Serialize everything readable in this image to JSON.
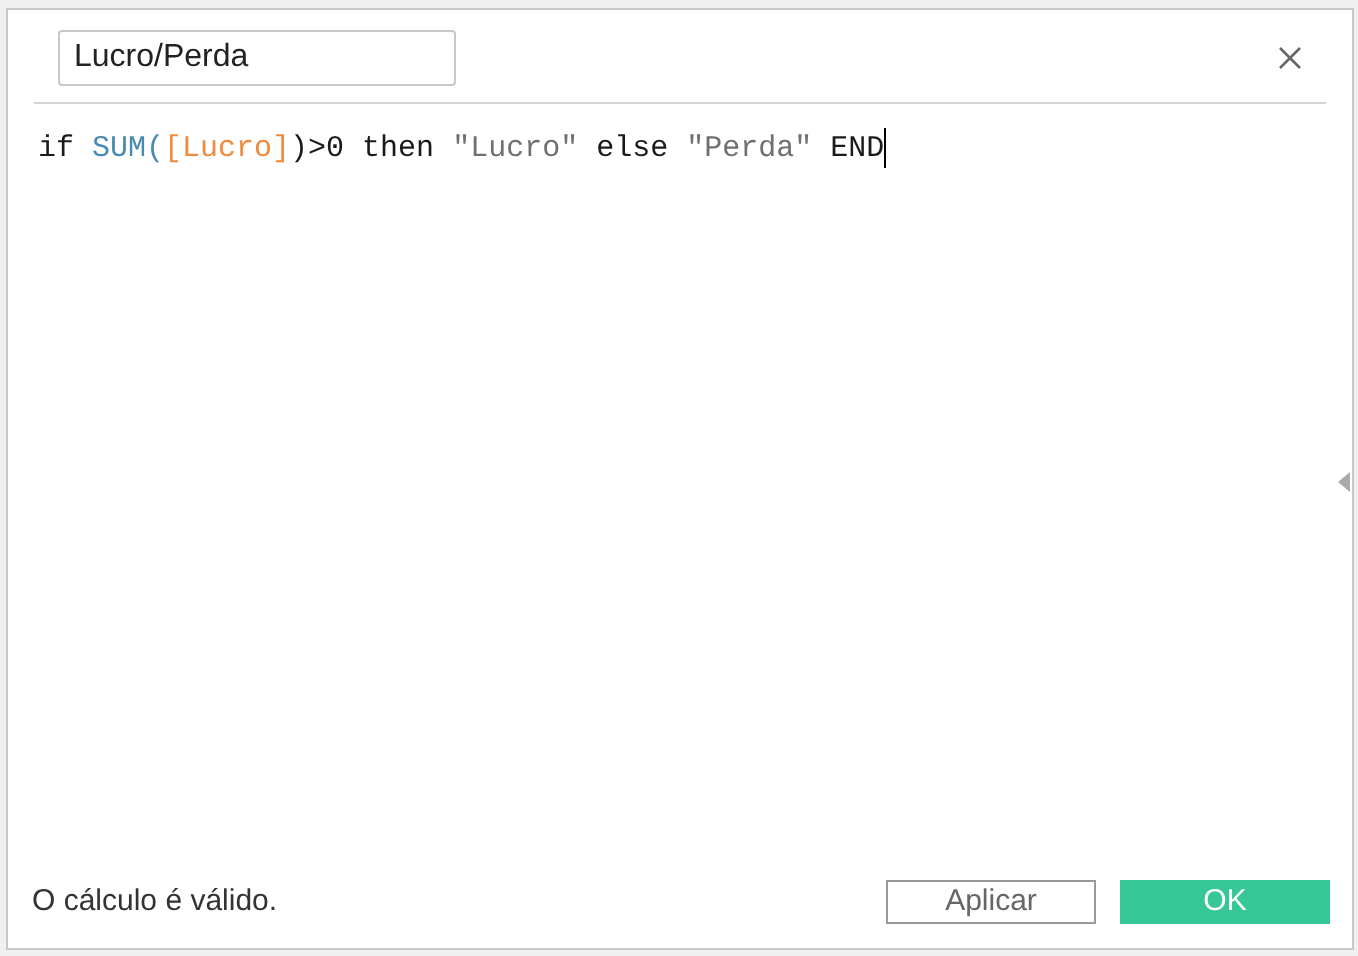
{
  "name_field": {
    "value": "Lucro/Perda"
  },
  "formula": [
    {
      "kind": "plain",
      "text": "if "
    },
    {
      "kind": "function",
      "text": "SUM("
    },
    {
      "kind": "field",
      "text": "[Lucro]"
    },
    {
      "kind": "plain",
      "text": ")>0 then "
    },
    {
      "kind": "string",
      "text": "\"Lucro\""
    },
    {
      "kind": "plain",
      "text": " else "
    },
    {
      "kind": "string",
      "text": "\"Perda\""
    },
    {
      "kind": "plain",
      "text": " END"
    }
  ],
  "status": "O cálculo é válido.",
  "buttons": [
    {
      "kind": "secondary",
      "label": "Aplicar"
    },
    {
      "kind": "primary",
      "label": "OK"
    }
  ]
}
